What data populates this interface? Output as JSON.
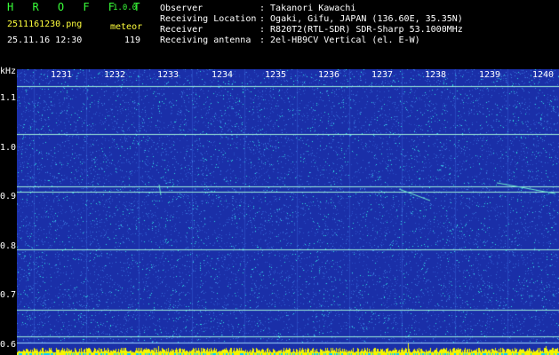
{
  "header": {
    "brand": "H R O F F T",
    "version": "1.0.0",
    "filename": "2511161230.png",
    "datetime": "25.11.16 12:30",
    "meteor_label": "meteor",
    "meteor_count": "119",
    "info": [
      {
        "label": "Observer",
        "value": ": Takanori Kawachi"
      },
      {
        "label": "Receiving Location",
        "value": ": Ogaki, Gifu, JAPAN (136.60E, 35.35N)"
      },
      {
        "label": "Receiver",
        "value": ": R820T2(RTL-SDR) SDR-Sharp 53.1000MHz"
      },
      {
        "label": "Receiving antenna",
        "value": ": 2el-HB9CV Vertical (el. E-W)"
      }
    ]
  },
  "chart_data": {
    "type": "heatmap",
    "ylabel": "kHz",
    "yticks": [
      "1.1",
      "1.0",
      "0.9",
      "0.8",
      "0.7",
      "0.6"
    ],
    "y_values": [
      1.1,
      1.0,
      0.9,
      0.8,
      0.7,
      0.6
    ],
    "ylim": [
      0.58,
      1.16
    ],
    "xticks": [
      "1231",
      "1232",
      "1233",
      "1234",
      "1235",
      "1236",
      "1237",
      "1238",
      "1239",
      "1240"
    ],
    "carrier_lines_khz": [
      1.125,
      1.028,
      0.922,
      0.912,
      0.794,
      0.672,
      0.617
    ],
    "colors": {
      "background": "#1a2fa8",
      "noise_dim": "#2a54c8",
      "noise_bright": "#2ee6e0",
      "line": "#9ff0d8",
      "bottom_bar": "#f5f500"
    }
  }
}
